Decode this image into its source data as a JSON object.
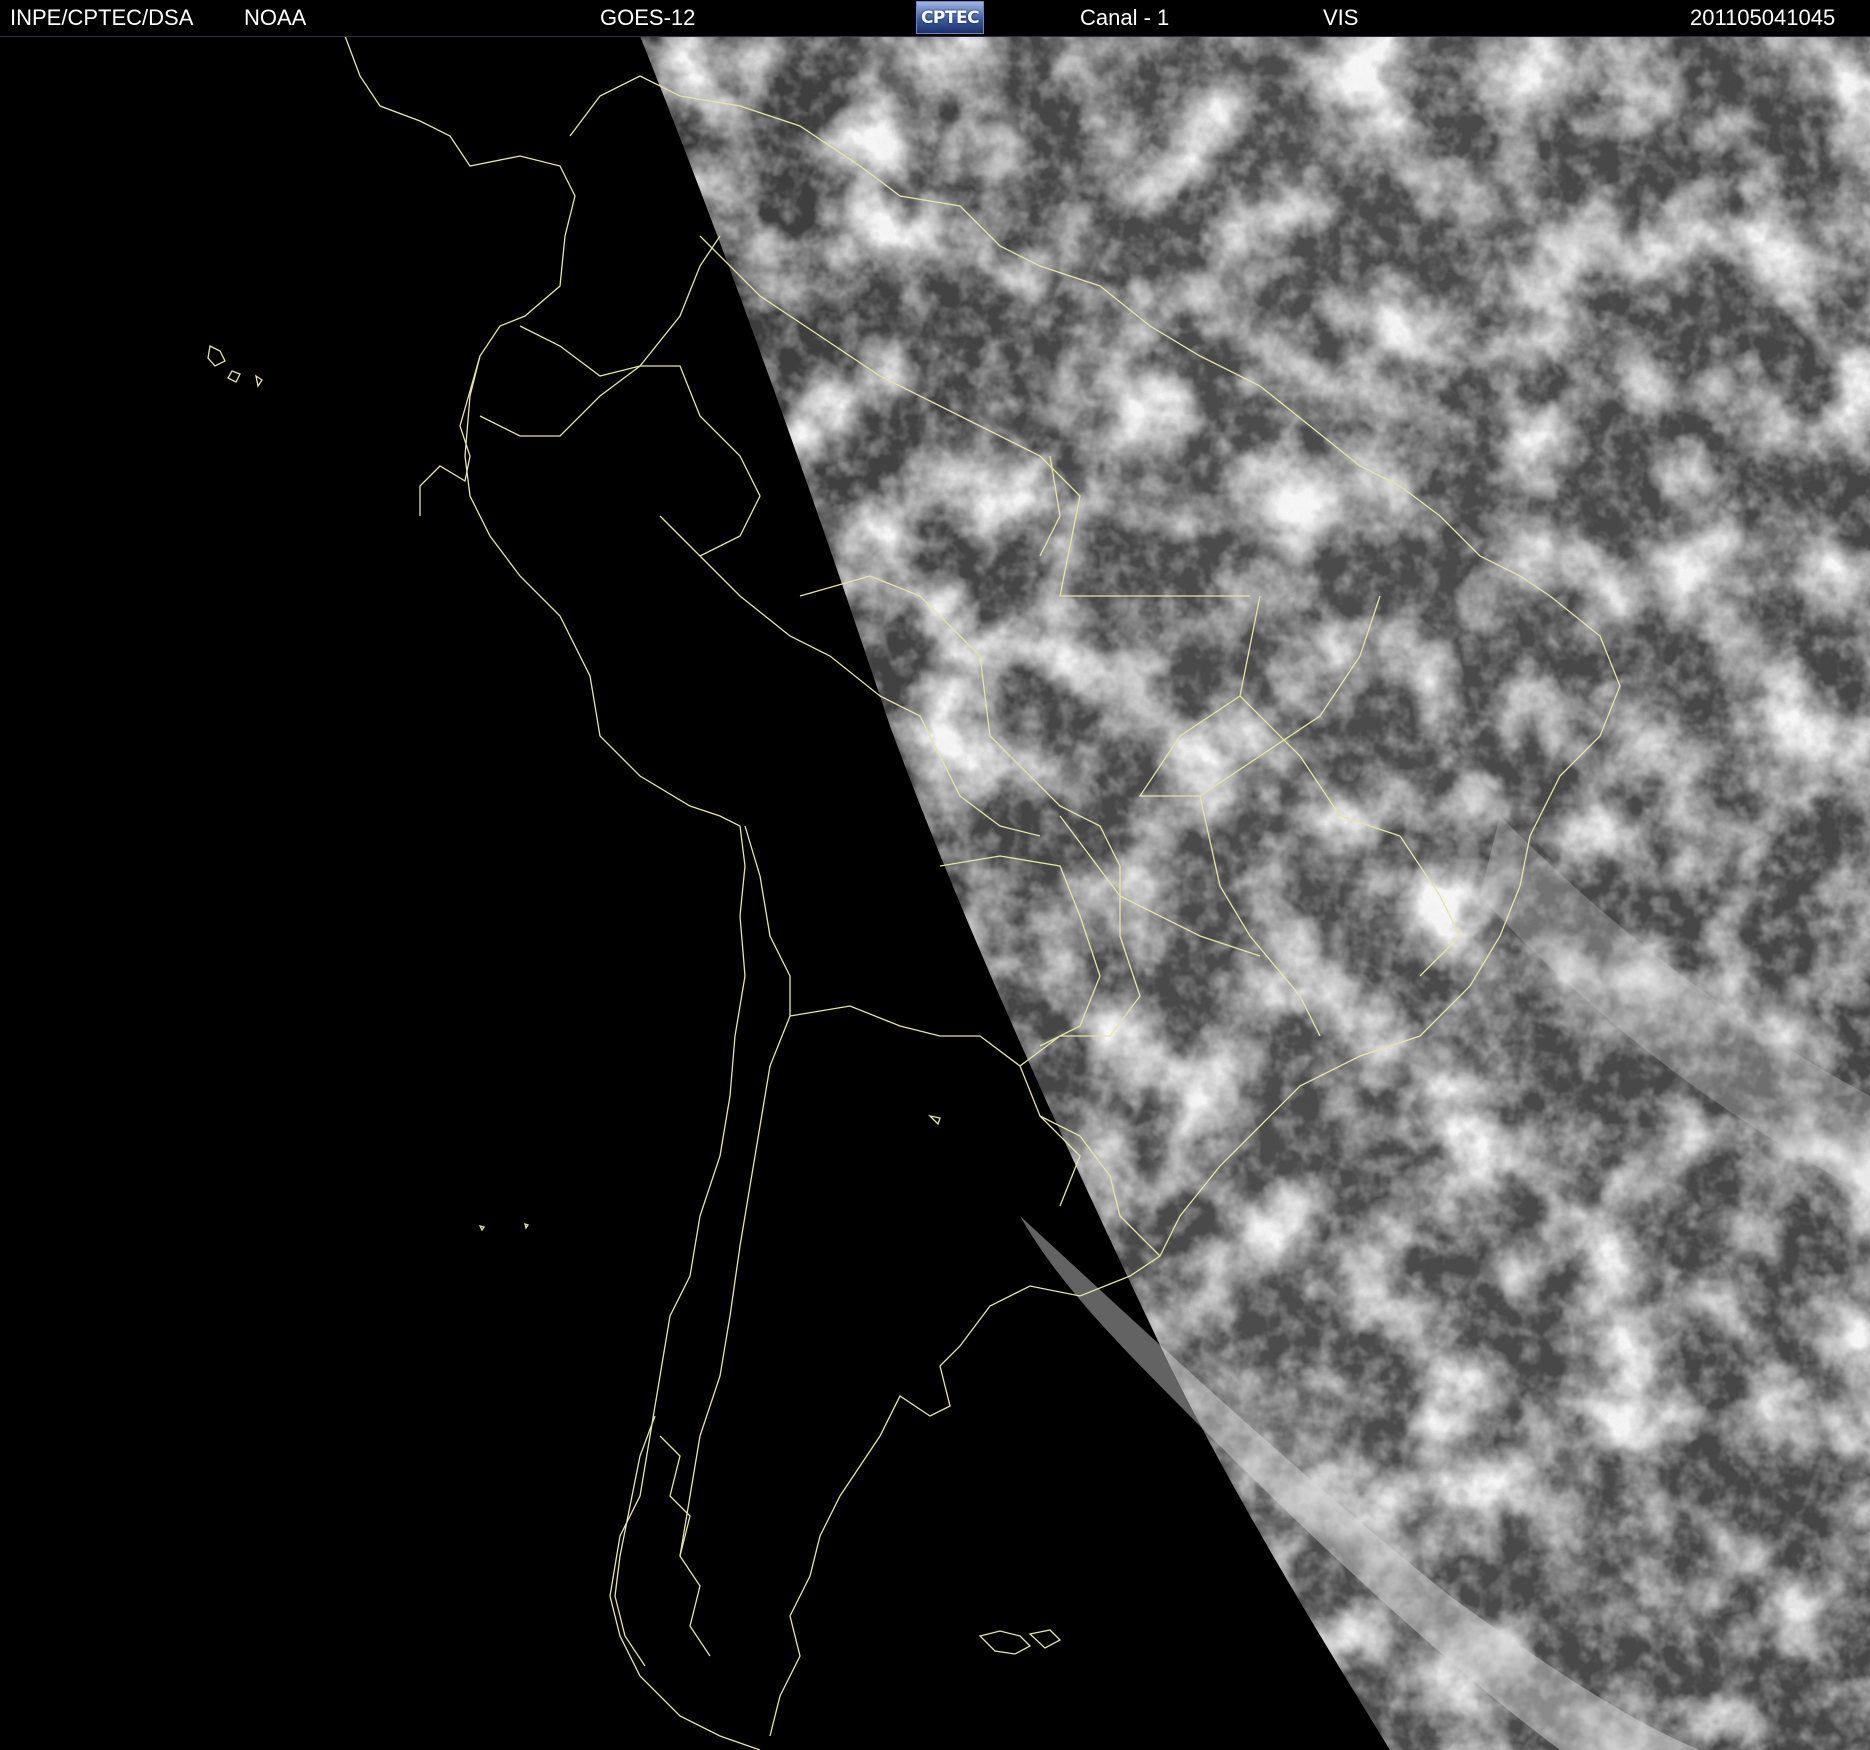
{
  "header": {
    "agency": "INPE/CPTEC/DSA",
    "source": "NOAA",
    "satellite": "GOES-12",
    "logo_text": "CPTEC",
    "channel": "Canal - 1",
    "band": "VIS",
    "timestamp": "201105041045"
  },
  "image": {
    "background_color": "#000000",
    "boundary_line_color": "#e6e6a0",
    "earth_base_color": "#4a4a4a",
    "cloud_color": "#e8e8e8"
  }
}
